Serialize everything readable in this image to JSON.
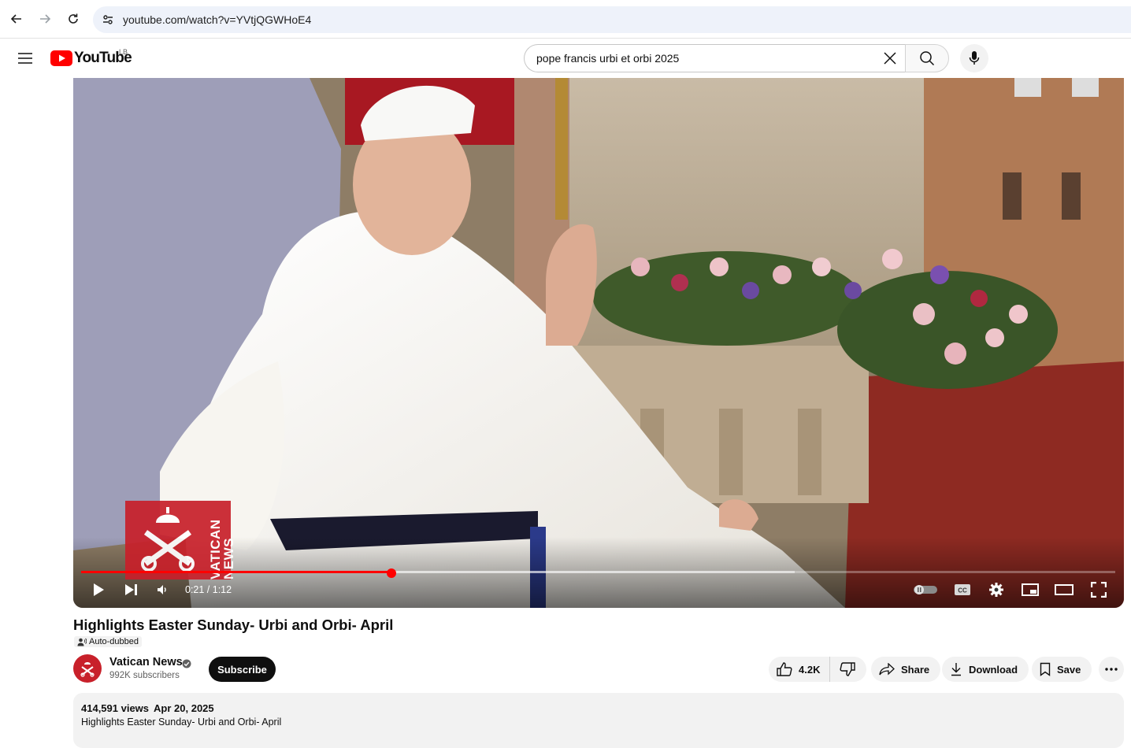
{
  "browser": {
    "url": "youtube.com/watch?v=YVtjQGWHoE4"
  },
  "masthead": {
    "logo_text": "YouTube",
    "country_code": "LB",
    "search_query": "pope francis urbi et orbi 2025"
  },
  "player": {
    "watermark_text": "VATICAN NEWS",
    "time_display": "0:21 / 1:12",
    "progress_played_fraction": 0.3,
    "progress_buffered_fraction": 0.69
  },
  "video": {
    "title": "Highlights Easter Sunday- Urbi and Orbi- April",
    "auto_dubbed_label": "Auto-dubbed"
  },
  "channel": {
    "name": "Vatican News",
    "subscribers": "992K subscribers",
    "subscribe_label": "Subscribe"
  },
  "actions": {
    "like_count": "4.2K",
    "share_label": "Share",
    "download_label": "Download",
    "save_label": "Save"
  },
  "description": {
    "views": "414,591 views",
    "date": "Apr 20, 2025",
    "text": "Highlights Easter Sunday- Urbi and Orbi- April"
  },
  "colors": {
    "brand_red": "#ff0000",
    "vatican_red": "#c8202a",
    "surface_gray": "#f2f2f2"
  }
}
